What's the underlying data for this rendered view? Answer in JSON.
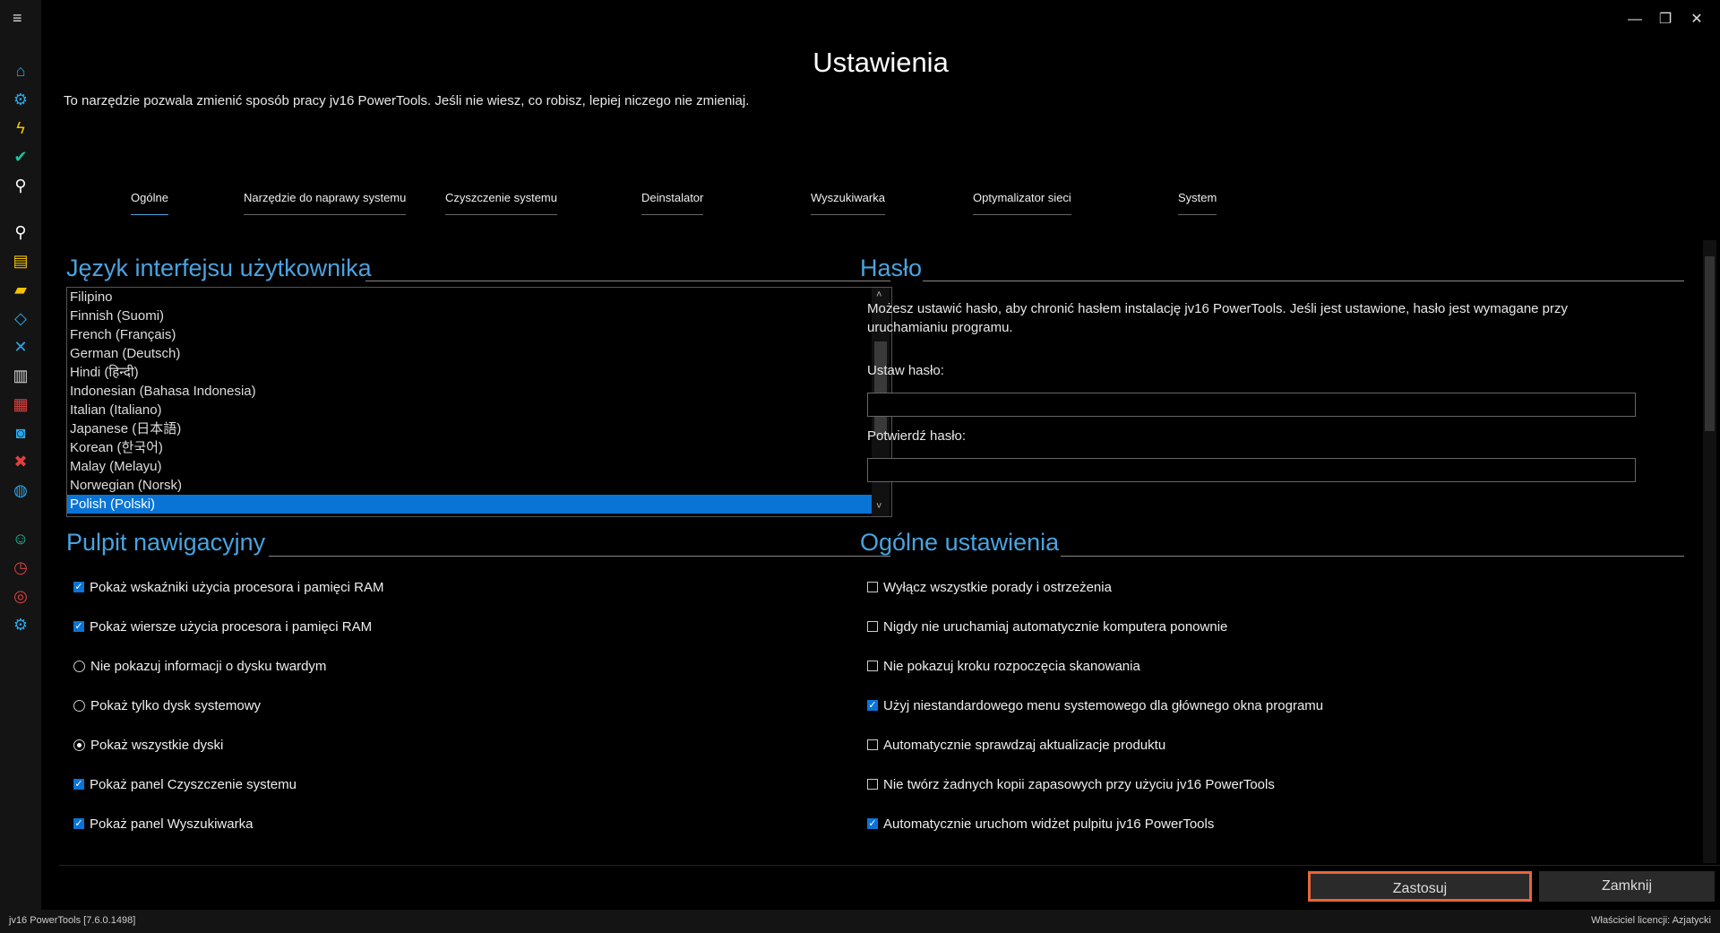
{
  "window": {
    "title": "Ustawienia",
    "description": "To narzędzie pozwala zmienić sposób pracy jv16 PowerTools. Jeśli nie wiesz, co robisz, lepiej niczego nie zmieniaj.",
    "controls": {
      "minimize": "—",
      "maximize": "❐",
      "close": "✕"
    }
  },
  "sidebar": {
    "menu_glyph": "≡",
    "icons": [
      {
        "name": "home-icon",
        "glyph": "⌂",
        "color": "#2aa7e8"
      },
      {
        "name": "gear-repair-icon",
        "glyph": "⚙",
        "color": "#2aa7e8"
      },
      {
        "name": "lightning-icon",
        "glyph": "ϟ",
        "color": "#f2c200"
      },
      {
        "name": "check-icon",
        "glyph": "✔",
        "color": "#1cc0a0"
      },
      {
        "name": "search-icon",
        "glyph": "⚲",
        "color": "#ffffff"
      },
      {
        "name": "zoom-icon",
        "glyph": "⚲",
        "color": "#ffffff"
      },
      {
        "name": "files-icon",
        "glyph": "▤",
        "color": "#f2c200"
      },
      {
        "name": "folder-icon",
        "glyph": "▰",
        "color": "#f2c200"
      },
      {
        "name": "code-icon",
        "glyph": "◇",
        "color": "#2aa7e8"
      },
      {
        "name": "merge-icon",
        "glyph": "✕",
        "color": "#2aa7e8"
      },
      {
        "name": "trash-icon",
        "glyph": "▥",
        "color": "#cfcfcf"
      },
      {
        "name": "shredder-icon",
        "glyph": "▦",
        "color": "#e04040"
      },
      {
        "name": "monitor-icon",
        "glyph": "◙",
        "color": "#2aa7e8"
      },
      {
        "name": "block-icon",
        "glyph": "✖",
        "color": "#e04040"
      },
      {
        "name": "globe-icon",
        "glyph": "◍",
        "color": "#2aa7e8"
      },
      {
        "name": "user-icon",
        "glyph": "☺",
        "color": "#1cc0a0"
      },
      {
        "name": "clock-icon",
        "glyph": "◷",
        "color": "#e04040"
      },
      {
        "name": "lifebuoy-icon",
        "glyph": "◎",
        "color": "#e04040"
      },
      {
        "name": "settings-icon",
        "glyph": "⚙",
        "color": "#2aa7e8"
      }
    ]
  },
  "tabs": [
    {
      "label": "Ogólne",
      "active": true
    },
    {
      "label": "Narzędzie do naprawy systemu"
    },
    {
      "label": "Czyszczenie systemu"
    },
    {
      "label": "Deinstalator"
    },
    {
      "label": "Wyszukiwarka"
    },
    {
      "label": "Optymalizator sieci"
    },
    {
      "label": "System"
    }
  ],
  "language": {
    "title": "Język interfejsu użytkownika",
    "items": [
      "Filipino",
      "Finnish (Suomi)",
      "French (Français)",
      "German (Deutsch)",
      "Hindi (हिन्दी)",
      "Indonesian (Bahasa Indonesia)",
      "Italian (Italiano)",
      "Japanese (日本語)",
      "Korean (한국어)",
      "Malay (Melayu)",
      "Norwegian (Norsk)",
      "Polish (Polski)"
    ],
    "selected": "Polish (Polski)",
    "scroll_up": "˄",
    "scroll_down": "˅"
  },
  "password": {
    "title": "Hasło",
    "description_line1": "Możesz ustawić hasło, aby chronić hasłem instalację jv16 PowerTools. Jeśli jest ustawione, hasło jest wymagane przy",
    "description_line2": "uruchamianiu programu.",
    "set_label": "Ustaw hasło:",
    "confirm_label": "Potwierdź hasło:"
  },
  "dashboard": {
    "title": "Pulpit nawigacyjny",
    "options": [
      {
        "type": "checkbox",
        "checked": true,
        "label": "Pokaż wskaźniki użycia procesora i pamięci RAM"
      },
      {
        "type": "checkbox",
        "checked": true,
        "label": "Pokaż wiersze użycia procesora i pamięci RAM"
      },
      {
        "type": "radio",
        "checked": false,
        "label": "Nie pokazuj informacji o dysku twardym"
      },
      {
        "type": "radio",
        "checked": false,
        "label": "Pokaż tylko dysk systemowy"
      },
      {
        "type": "radio",
        "checked": true,
        "label": "Pokaż wszystkie dyski"
      },
      {
        "type": "checkbox",
        "checked": true,
        "label": "Pokaż panel Czyszczenie systemu"
      },
      {
        "type": "checkbox",
        "checked": true,
        "label": "Pokaż panel Wyszukiwarka"
      }
    ]
  },
  "general": {
    "title": "Ogólne ustawienia",
    "options": [
      {
        "checked": false,
        "label": "Wyłącz wszystkie porady i ostrzeżenia"
      },
      {
        "checked": false,
        "label": "Nigdy nie uruchamiaj automatycznie komputera ponownie"
      },
      {
        "checked": false,
        "label": "Nie pokazuj kroku rozpoczęcia skanowania"
      },
      {
        "checked": true,
        "label": "Użyj niestandardowego menu systemowego dla głównego okna programu"
      },
      {
        "checked": false,
        "label": "Automatycznie sprawdzaj aktualizacje produktu"
      },
      {
        "checked": false,
        "label": "Nie twórz żadnych kopii zapasowych przy użyciu jv16 PowerTools"
      },
      {
        "checked": true,
        "label": "Automatycznie uruchom widżet pulpitu jv16 PowerTools"
      }
    ]
  },
  "buttons": {
    "apply": "Zastosuj",
    "close": "Zamknij"
  },
  "statusbar": {
    "version": "jv16 PowerTools [7.6.0.1498]",
    "license": "Właściciel licencji: Azjatycki"
  },
  "colors": {
    "accent": "#4aa3df",
    "selection": "#0a74d6",
    "apply_border": "#e8643a"
  }
}
